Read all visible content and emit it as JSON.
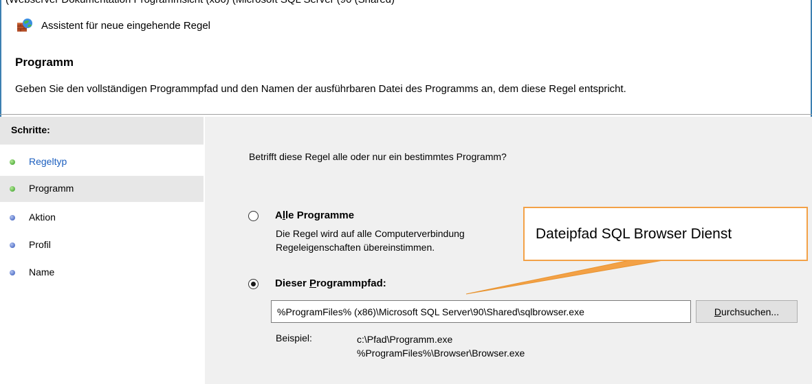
{
  "top_cut_text": "(Webserver Dokumentation Programmsicht (x86) (Microsoft SQL Server (90 (Shared)",
  "window": {
    "title": "Assistent für neue eingehende Regel",
    "icon": "firewall-wizard-icon"
  },
  "header": {
    "title": "Programm",
    "description": "Geben Sie den vollständigen Programmpfad und den Namen der ausführbaren Datei des Programms an, dem diese Regel entspricht."
  },
  "sidebar": {
    "heading": "Schritte:",
    "steps": [
      {
        "label": "Regeltyp",
        "status": "completed",
        "color": "#2f9a1e"
      },
      {
        "label": "Programm",
        "status": "current",
        "color": "#2f9a1e"
      },
      {
        "label": "Aktion",
        "status": "pending",
        "color": "#2e52b8"
      },
      {
        "label": "Profil",
        "status": "pending",
        "color": "#2e52b8"
      },
      {
        "label": "Name",
        "status": "pending",
        "color": "#2e52b8"
      }
    ]
  },
  "main": {
    "question": "Betrifft diese Regel alle oder nur ein bestimmtes Programm?",
    "option_all": {
      "label_prefix": "A",
      "label_underlined": "l",
      "label_suffix": "le Programme",
      "selected": false,
      "desc_line1": "Die Regel wird auf alle Computerverbindung",
      "desc_line2": "Regeleigenschaften übereinstimmen."
    },
    "option_path": {
      "label_prefix": "Dieser ",
      "label_underlined": "P",
      "label_suffix": "rogrammpfad:",
      "selected": true
    },
    "path_value": "%ProgramFiles% (x86)\\Microsoft SQL Server\\90\\Shared\\sqlbrowser.exe",
    "browse_button": {
      "underlined": "D",
      "rest": "urchsuchen..."
    },
    "example_label": "Beispiel:",
    "example_line1": "c:\\Pfad\\Programm.exe",
    "example_line2": "%ProgramFiles%\\Browser\\Browser.exe"
  },
  "callout": {
    "text": "Dateipfad SQL Browser Dienst",
    "color": "#f3a146"
  }
}
